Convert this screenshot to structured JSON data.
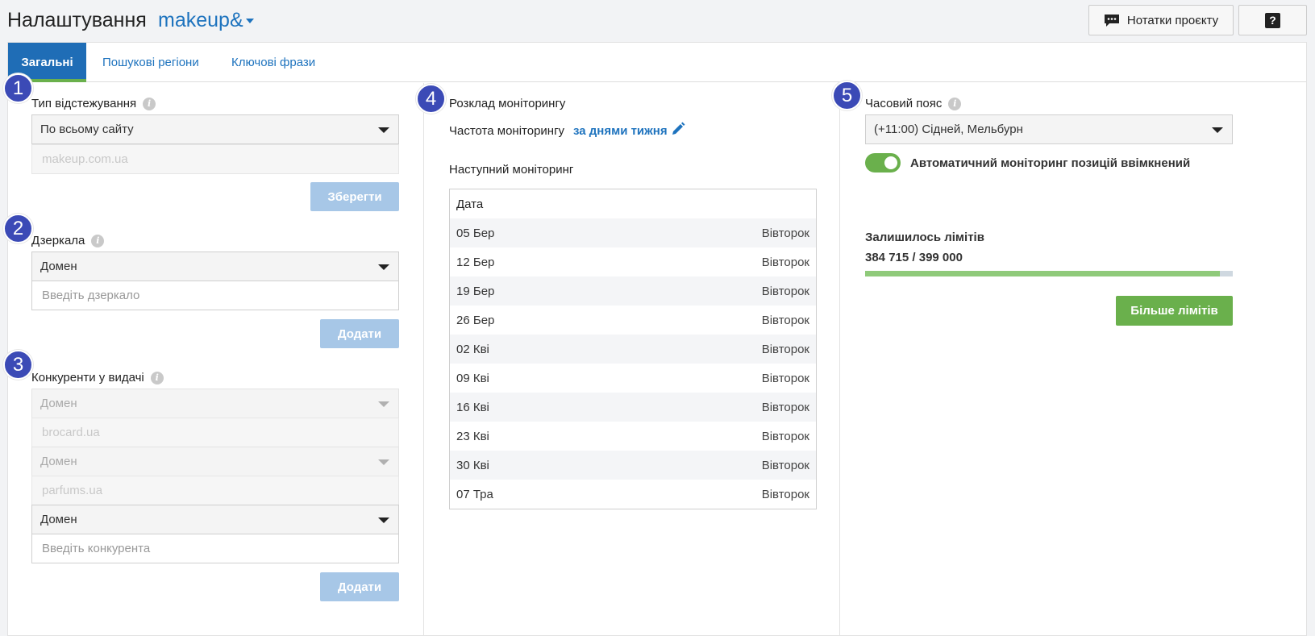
{
  "header": {
    "title": "Налаштування",
    "project": "makeup&",
    "notes_button": "Нотатки проєкту",
    "help_button": "?",
    "notes_icon": "comment-icon"
  },
  "tabs": [
    {
      "label": "Загальні",
      "active": true
    },
    {
      "label": "Пошукові регіони",
      "active": false
    },
    {
      "label": "Ключові фрази",
      "active": false
    }
  ],
  "tracking": {
    "badge": "1",
    "label": "Тип відстежування",
    "select_value": "По всьому сайту",
    "domain_value": "makeup.com.ua",
    "save_button": "Зберегти"
  },
  "mirrors": {
    "badge": "2",
    "label": "Дзеркала",
    "select_value": "Домен",
    "input_placeholder": "Введіть дзеркало",
    "add_button": "Додати"
  },
  "competitors": {
    "badge": "3",
    "label": "Конкуренти у видачі",
    "items": [
      {
        "type": "Домен",
        "domain": "brocard.ua"
      },
      {
        "type": "Домен",
        "domain": "parfums.ua"
      }
    ],
    "new_select_value": "Домен",
    "input_placeholder": "Введіть конкурента",
    "add_button": "Додати"
  },
  "schedule": {
    "badge": "4",
    "label": "Розклад моніторингу",
    "frequency_label": "Частота моніторингу",
    "frequency_value": "за днями тижня",
    "next_label": "Наступний моніторинг",
    "table_header": "Дата",
    "rows": [
      {
        "date": "05 Бер",
        "day": "Вівторок"
      },
      {
        "date": "12 Бер",
        "day": "Вівторок"
      },
      {
        "date": "19 Бер",
        "day": "Вівторок"
      },
      {
        "date": "26 Бер",
        "day": "Вівторок"
      },
      {
        "date": "02 Кві",
        "day": "Вівторок"
      },
      {
        "date": "09 Кві",
        "day": "Вівторок"
      },
      {
        "date": "16 Кві",
        "day": "Вівторок"
      },
      {
        "date": "23 Кві",
        "day": "Вівторок"
      },
      {
        "date": "30 Кві",
        "day": "Вівторок"
      },
      {
        "date": "07 Тра",
        "day": "Вівторок"
      }
    ]
  },
  "timezone": {
    "badge": "5",
    "label": "Часовий пояс",
    "select_value": "(+11:00) Сідней, Мельбурн",
    "auto_monitoring_label": "Автоматичний моніторинг позицій ввімкнений",
    "auto_monitoring_on": true
  },
  "limits": {
    "label": "Залишилось лімітів",
    "value_text": "384 715 / 399 000",
    "used_fraction": 0.964,
    "more_button": "Більше лімітів"
  },
  "colors": {
    "accent": "#1e73be",
    "badge": "#3b4ab6",
    "green": "#6ab04c"
  }
}
